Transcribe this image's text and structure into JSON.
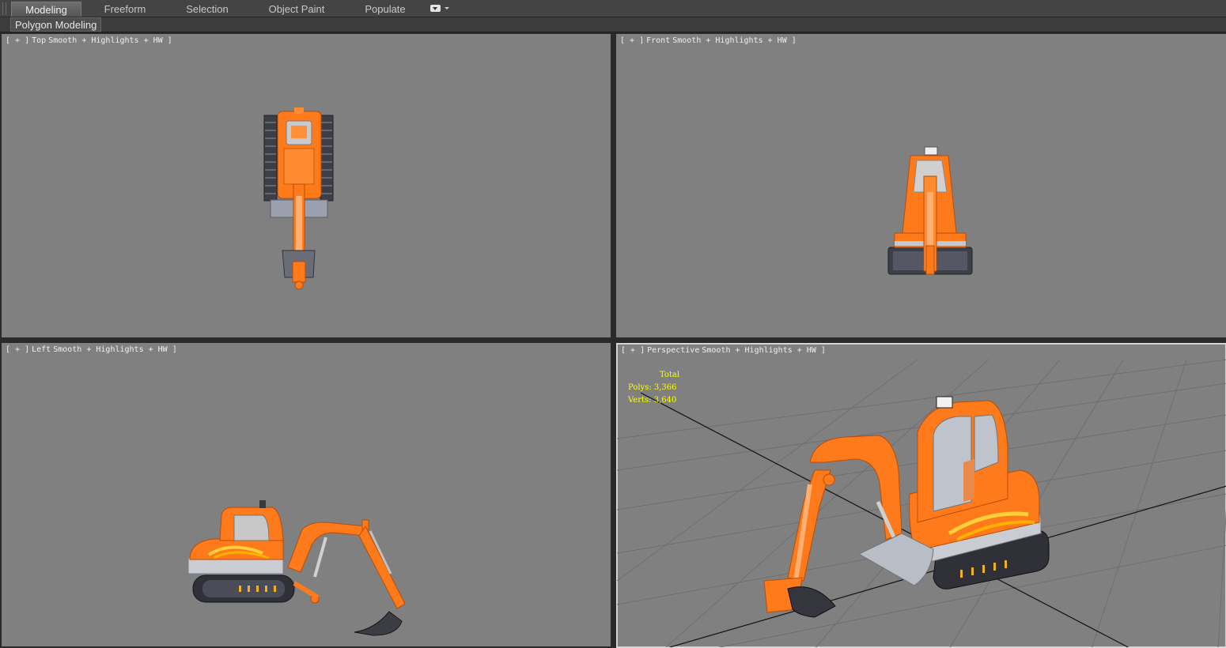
{
  "ribbon": {
    "tabs": [
      {
        "label": "Modeling",
        "active": true
      },
      {
        "label": "Freeform",
        "active": false
      },
      {
        "label": "Selection",
        "active": false
      },
      {
        "label": "Object Paint",
        "active": false
      },
      {
        "label": "Populate",
        "active": false
      }
    ],
    "panel_label": "Polygon Modeling"
  },
  "viewports": {
    "top": {
      "plus": "[ + ]",
      "view": "Top",
      "shading": "Smooth + Highlights + HW ]"
    },
    "front": {
      "plus": "[ + ]",
      "view": "Front",
      "shading": "Smooth + Highlights + HW ]"
    },
    "left": {
      "plus": "[ + ]",
      "view": "Left",
      "shading": "Smooth + Highlights + HW ]"
    },
    "perspective": {
      "plus": "[ + ]",
      "view": "Perspective",
      "shading": "Smooth + Highlights + HW ]"
    }
  },
  "stats": {
    "header": "Total",
    "polys_label": "Polys:",
    "polys_value": "3,366",
    "verts_label": "Verts:",
    "verts_value": "3,640"
  },
  "colors": {
    "viewport_bg": "#808080",
    "excavator_body": "#ff7a1a",
    "stats_text": "#ffff00"
  }
}
